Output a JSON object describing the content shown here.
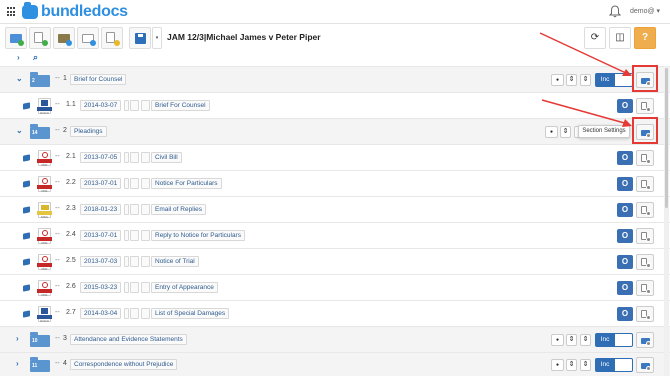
{
  "app": {
    "logo_text": "bundledocs",
    "user_label": "demo@ ▾"
  },
  "toolbar": {
    "bundle_title": "JAM 12/3|Michael James v Peter Piper",
    "dropdown_caret": "▾",
    "refresh_icon": "⟳",
    "columns_icon": "◫",
    "help_icon": "?"
  },
  "filter_bar": {
    "expand_all": "›",
    "search_icon": "⌕"
  },
  "rows": [
    {
      "kind": "section",
      "expanded": true,
      "folder_num": "2",
      "num": "1",
      "title": "Brief for Counsel",
      "toggle": "Inc"
    },
    {
      "kind": "doc",
      "file": "word",
      "file_label": "DOCX",
      "num": "1.1",
      "date": "2014-03-07",
      "title": "Brief For Counsel"
    },
    {
      "kind": "section",
      "expanded": true,
      "folder_num": "14",
      "num": "2",
      "title": "Pleadings"
    },
    {
      "kind": "doc",
      "file": "pdf",
      "file_label": "PDF",
      "num": "2.1",
      "date": "2013-07-05",
      "title": "Civil Bill"
    },
    {
      "kind": "doc",
      "file": "pdf",
      "file_label": "PDF",
      "num": "2.2",
      "date": "2013-07-01",
      "title": "Notice For Particulars"
    },
    {
      "kind": "doc",
      "file": "mail",
      "file_label": "MSG",
      "num": "2.3",
      "date": "2018-01-23",
      "title": "Email of Replies"
    },
    {
      "kind": "doc",
      "file": "pdf",
      "file_label": "PDF",
      "num": "2.4",
      "date": "2013-07-01",
      "title": "Reply to Notice for Particulars"
    },
    {
      "kind": "doc",
      "file": "pdf",
      "file_label": "PDF",
      "num": "2.5",
      "date": "2013-07-03",
      "title": "Notice of Trial"
    },
    {
      "kind": "doc",
      "file": "pdf",
      "file_label": "PDF",
      "num": "2.6",
      "date": "2015-03-23",
      "title": "Entry of Appearance"
    },
    {
      "kind": "doc",
      "file": "word",
      "file_label": "DOCX",
      "num": "2.7",
      "date": "2014-03-04",
      "title": "List of Special Damages"
    },
    {
      "kind": "section",
      "expanded": false,
      "folder_num": "10",
      "num": "3",
      "title": "Attendance and Evidence Statements",
      "toggle": "Inc"
    },
    {
      "kind": "section",
      "expanded": false,
      "folder_num": "11",
      "num": "4",
      "title": "Correspondence without Prejudice",
      "toggle": "Inc"
    }
  ],
  "row_controls": {
    "comment_icon": "●",
    "sort_icon": "⇕",
    "open_icon": "O",
    "expanded_chevron": "⌄",
    "collapsed_chevron": "›",
    "dash": "--"
  },
  "tooltip": {
    "text": "Section Settings"
  },
  "colors": {
    "brand": "#2f8fe0",
    "primary": "#2f6db5",
    "help": "#f0ad4e",
    "annotation": "#e53935"
  }
}
